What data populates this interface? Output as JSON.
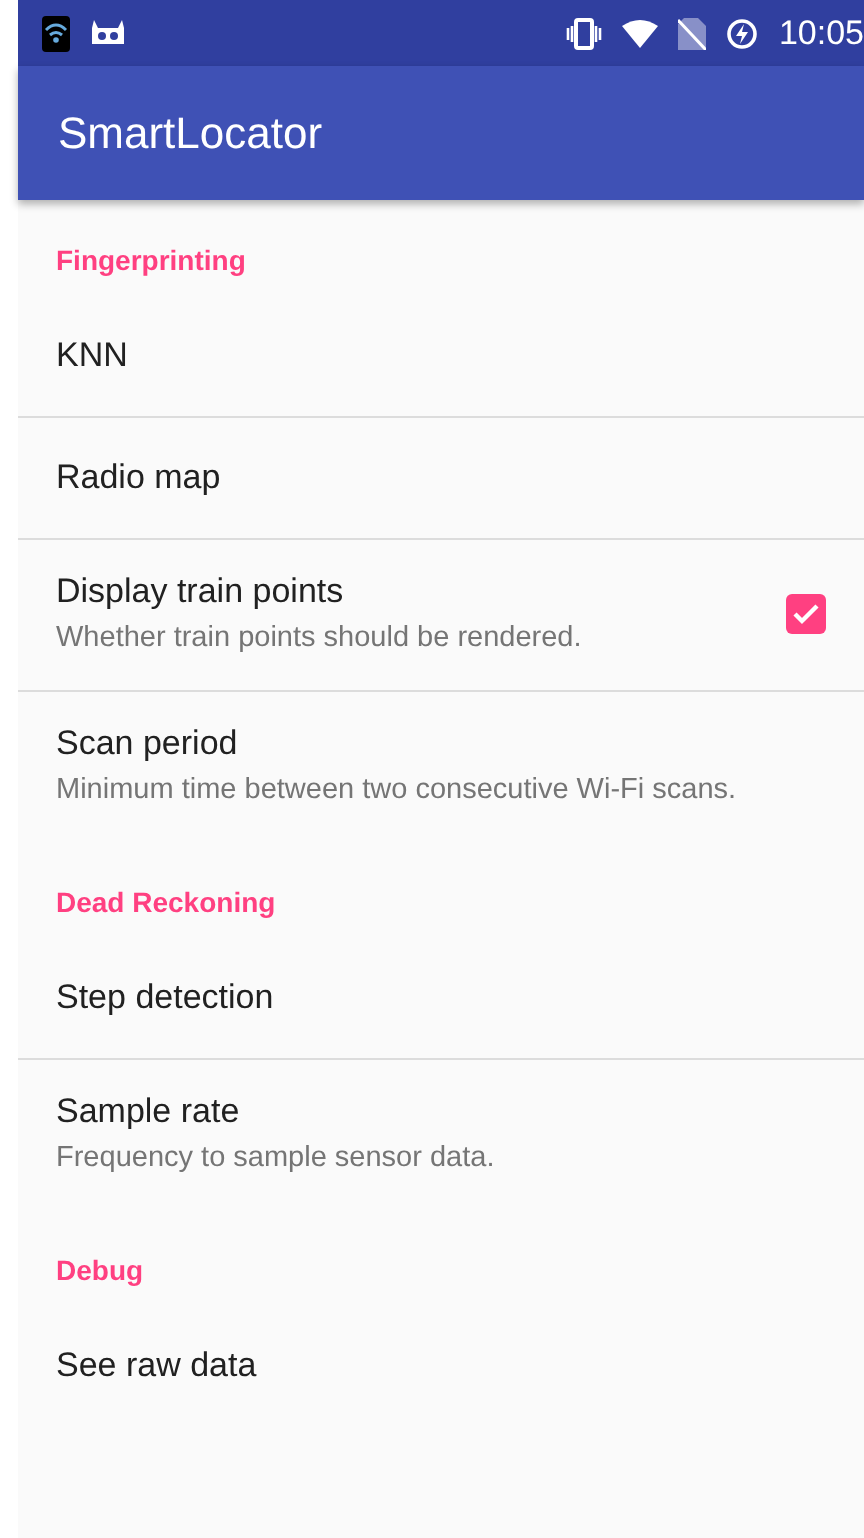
{
  "status_bar": {
    "time": "10:05"
  },
  "app_bar": {
    "title": "SmartLocator"
  },
  "categories": [
    {
      "title": "Fingerprinting",
      "items": [
        {
          "kind": "plain",
          "title": "KNN"
        },
        {
          "kind": "plain",
          "title": "Radio map"
        },
        {
          "kind": "checkbox",
          "title": "Display train points",
          "summary": "Whether train points should be rendered.",
          "checked": true
        },
        {
          "kind": "plain",
          "title": "Scan period",
          "summary": "Minimum time between two consecutive Wi-Fi scans."
        }
      ]
    },
    {
      "title": "Dead Reckoning",
      "items": [
        {
          "kind": "plain",
          "title": "Step detection"
        },
        {
          "kind": "plain",
          "title": "Sample rate",
          "summary": "Frequency to sample sensor data."
        }
      ]
    },
    {
      "title": "Debug",
      "items": [
        {
          "kind": "plain",
          "title": "See raw data"
        }
      ]
    }
  ]
}
